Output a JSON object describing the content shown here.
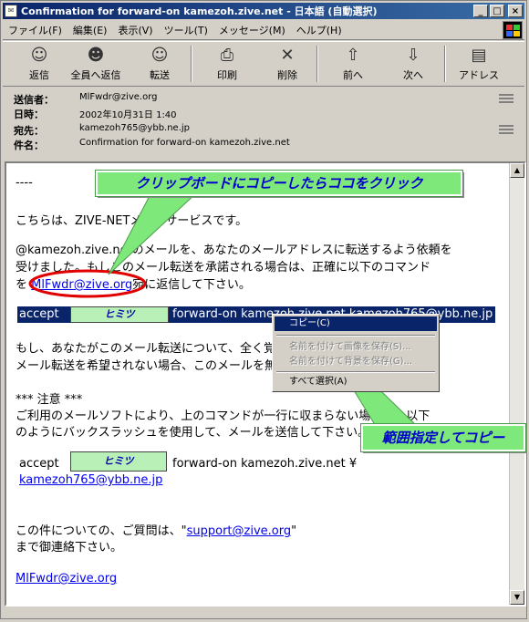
{
  "window": {
    "title": "Confirmation for forward-on kamezoh.zive.net - 日本語 (自動選択)",
    "minimize": "_",
    "maximize": "□",
    "close": "×"
  },
  "menu": [
    "ファイル(F)",
    "編集(E)",
    "表示(V)",
    "ツール(T)",
    "メッセージ(M)",
    "ヘルプ(H)"
  ],
  "toolbar": [
    {
      "label": "返信",
      "icon": "reply-icon",
      "glyph": "☺"
    },
    {
      "label": "全員へ返信",
      "icon": "reply-all-icon",
      "glyph": "☻"
    },
    {
      "label": "転送",
      "icon": "forward-icon",
      "glyph": "☺"
    },
    {
      "label": "印刷",
      "icon": "print-icon",
      "glyph": "⎙"
    },
    {
      "label": "削除",
      "icon": "delete-icon",
      "glyph": "✕"
    },
    {
      "label": "前へ",
      "icon": "previous-icon",
      "glyph": "⇧"
    },
    {
      "label": "次へ",
      "icon": "next-icon",
      "glyph": "⇩"
    },
    {
      "label": "アドレス",
      "icon": "address-book-icon",
      "glyph": "▤"
    }
  ],
  "headers": {
    "from_label": "送信者：",
    "from": "MlFwdr@zive.org",
    "date_label": "日時：",
    "date": "2002年10月31日 1:40",
    "to_label": "宛先：",
    "to": "kamezoh765@ybb.ne.jp",
    "subject_label": "件名：",
    "subject": "Confirmation for forward-on kamezoh.zive.net"
  },
  "body": {
    "line_dashes": "----",
    "line_intro": "こちらは、ZIVE-NETメールサービスです。",
    "line_req1": "@kamezoh.zive.netのメールを、あなたのメールアドレスに転送するよう依頼を",
    "line_req2": "受けました。もしこのメール転送を承諾される場合は、正確に以下のコマンド",
    "line_req3_pre": "を",
    "line_req3_link": "MlFwdr@zive.org",
    "line_req3_post": "宛に返信して下さい。",
    "cmd_accept": "accept",
    "cmd_secret": "ヒミツ",
    "cmd_rest": "forward-on kamezoh.zive.net kamezoh765@ybb.ne.jp",
    "line_ifnot1": "もし、あなたがこのメール転送について、全く覚えがない場合、あるいは、",
    "line_ifnot2": "メール転送を希望されない場合、このメールを無視して下さい。",
    "note_title": "*** 注意 ***",
    "note1": "ご利用のメールソフトにより、上のコマンドが一行に収まらない場合は、以下",
    "note2": "のようにバックスラッシュを使用して、メールを送信して下さい。",
    "cmd2_accept": "accept",
    "cmd2_secret": "ヒミツ",
    "cmd2_rest": "forward-on kamezoh.zive.net ¥",
    "cmd2_addr": "kamezoh765@ybb.ne.jp",
    "q_pre": "この件についての、ご質問は、\"",
    "q_link": "support@zive.org",
    "q_post": "\"",
    "q2": "まで御連絡下さい。",
    "sig": "MlFwdr@zive.org"
  },
  "context_menu": {
    "copy": "コピー(C)",
    "save_image": "名前を付けて画像を保存(S)...",
    "save_bg": "名前を付けて背景を保存(G)...",
    "select_all": "すべて選択(A)"
  },
  "callouts": {
    "top": "クリップボードにコピーしたらココをクリック",
    "bottom": "範囲指定してコピー"
  },
  "colors": {
    "titlebar": "#0a246a",
    "selection": "#0a246a",
    "callout_bg": "#7ee87a",
    "callout_text": "#0000cc",
    "ellipse": "#e00000",
    "link": "#0000ee"
  }
}
